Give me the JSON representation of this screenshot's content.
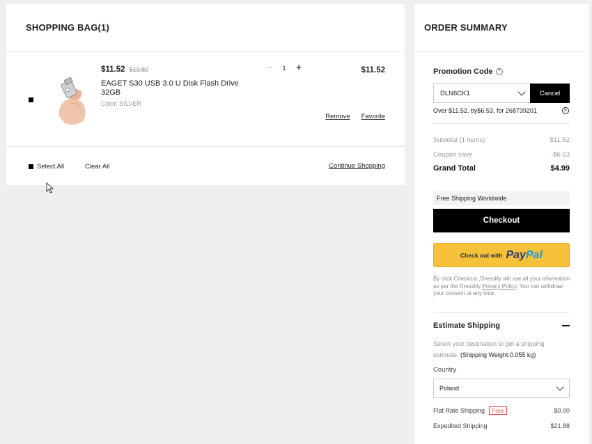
{
  "bag": {
    "title": "SHOPPING BAG(1)",
    "item": {
      "price": "$11.52",
      "old_price": "$13.82",
      "name": "EAGET S30 USB 3.0 U Disk Flash Drive 32GB",
      "color": "Color: SILVER",
      "quantity": "1",
      "total": "$11.52",
      "remove_label": "Remove",
      "favorite_label": "Favorite"
    },
    "footer": {
      "select_all": "Select All",
      "clear_all": "Clear All",
      "continue_shopping": "Continue Shopping"
    }
  },
  "summary": {
    "title": "ORDER SUMMARY",
    "promo_label": "Promotion Code",
    "promo_code": "DLN6CK1",
    "promo_cancel": "Cancel",
    "promo_note": "Over $11.52, by$6.53, for 268739201",
    "subtotal_label": "Subtotal (1 items)",
    "subtotal_value": "$11.52",
    "coupon_label": "Coupon save",
    "coupon_value": "-$6.53",
    "grand_label": "Grand Total",
    "grand_value": "$4.99",
    "free_shipping_banner": "Free Shipping Worldwide",
    "checkout_label": "Checkout",
    "paypal_prefix": "Check out with",
    "paypal_pay": "Pay",
    "paypal_pal": "Pal",
    "consent_before": "By click Checkout ,Dresslily will use all your information as per the Dresslily ",
    "consent_link": "Privacy Policy",
    "consent_after": ". You can withdraw your consent at any time.",
    "estimate_title": "Estimate Shipping",
    "estimate_text": "Select your destination to get a shipping estimate.",
    "estimate_weight": "(Shipping Weight:0.055 kg)",
    "country_label": "Country",
    "country_value": "Poland",
    "flat_label": "Flat Rate Shipping",
    "flat_badge": "Free",
    "flat_value": "$0.00",
    "expedited_label": "Expedited Shipping",
    "expedited_value": "$21.88"
  },
  "colors": {
    "paypal_yellow": "#f7c13a",
    "paypal_blue_dark": "#253b80",
    "paypal_blue_light": "#179bd7",
    "free_badge_red": "#e84a4a"
  }
}
